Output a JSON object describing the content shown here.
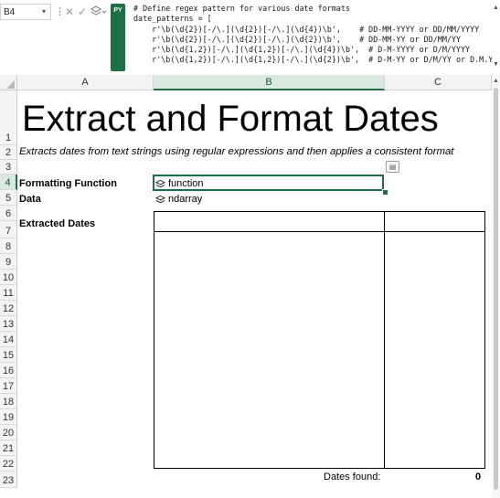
{
  "formula_bar": {
    "name_box": "B4",
    "python_badge": "PY",
    "code_lines": [
      "# Define regex pattern for various date formats",
      "date_patterns = [",
      "    r'\\b(\\d{2})[-/\\.](\\d{2})[-/\\.](\\d{4})\\b',    # DD-MM-YYYY or DD/MM/YYYY",
      "    r'\\b(\\d{2})[-/\\.](\\d{2})[-/\\.](\\d{2})\\b',    # DD-MM-YY or DD/MM/YY",
      "    r'\\b(\\d{1,2})[-/\\.](\\d{1,2})[-/\\.](\\d{4})\\b',  # D-M-YYYY or D/M/YYYY",
      "    r'\\b(\\d{1,2})[-/\\.](\\d{1,2})[-/\\.](\\d{2})\\b',  # D-M-YY or D/M/YY or D.M.YY"
    ]
  },
  "columns": [
    "A",
    "B",
    "C"
  ],
  "rows": [
    "1",
    "2",
    "3",
    "4",
    "5",
    "6",
    "7",
    "8",
    "9",
    "10",
    "11",
    "12",
    "13",
    "14",
    "15",
    "16",
    "17",
    "18",
    "19",
    "20",
    "21",
    "22",
    "23"
  ],
  "sheet": {
    "title": "Extract and Format Dates",
    "subtitle": "Extracts dates from text strings using regular expressions and then applies a consistent format",
    "formatting_function_label": "Formatting Function",
    "formatting_function_value": "function",
    "data_label": "Data",
    "data_value": "ndarray",
    "extracted_dates_label": "Extracted Dates",
    "dates_found_label": "Dates found:",
    "dates_found_value": "0"
  },
  "selection": {
    "cell": "B4",
    "column": "B",
    "row": "4"
  },
  "icons": [
    "python-object-icon",
    "insert-data-card-icon",
    "cancel-icon",
    "enter-check-icon",
    "python-mode-icon"
  ],
  "colors": {
    "excel_green": "#1f7145",
    "header_bg": "#f3f3f3",
    "selected_header_bg": "#d9e9de"
  }
}
